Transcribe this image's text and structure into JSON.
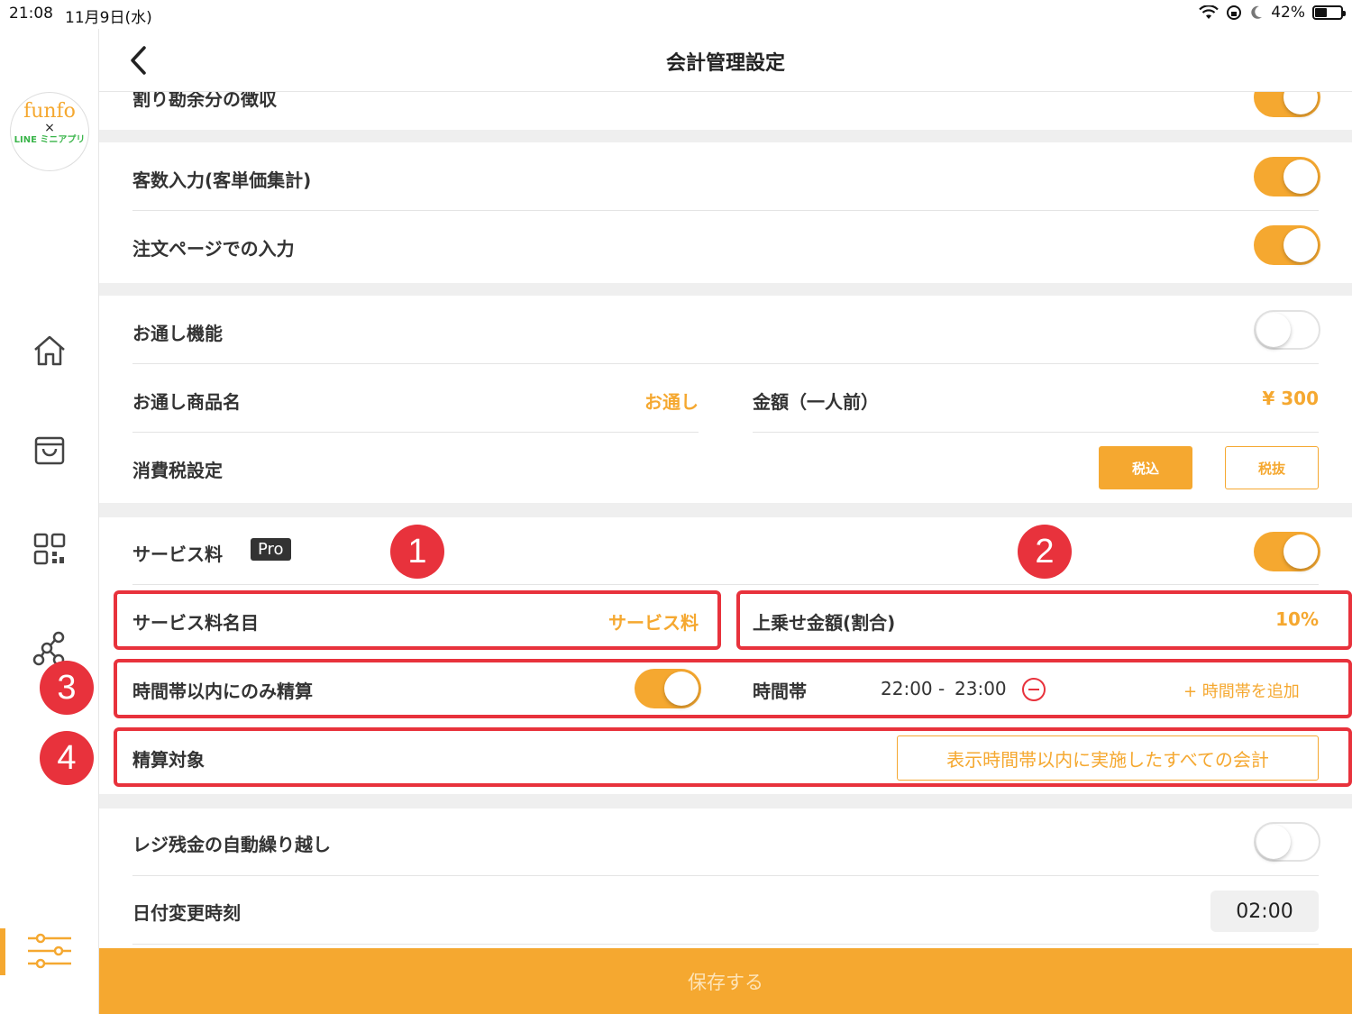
{
  "status": {
    "time": "21:08",
    "date": "11月9日(水)",
    "battery": "42%",
    "battery_level": 0.42
  },
  "logo": {
    "line1": "funfo",
    "line2": "×",
    "line3": "LINE ミニアプリ"
  },
  "header": {
    "title": "会計管理設定"
  },
  "rows": {
    "partial_top": "割り勘余分の徴収",
    "guest_count": "客数入力(客単価集計)",
    "order_page_input": "注文ページでの入力",
    "otoshi_feature": "お通し機能",
    "otoshi_name_label": "お通し商品名",
    "otoshi_name_value": "お通し",
    "amount_label": "金額（一人前）",
    "amount_value": "¥ 300",
    "tax_label": "消費税設定",
    "tax_included": "税込",
    "tax_excluded": "税抜",
    "service_fee": "サービス料",
    "pro_badge": "Pro",
    "service_name_label": "サービス料名目",
    "service_name_value": "サービス料",
    "surcharge_label": "上乗せ金額(割合)",
    "surcharge_value": "10%",
    "time_only_label": "時間帯以内にのみ精算",
    "time_slot_label": "時間帯",
    "time_start": "22:00 -",
    "time_end": "23:00",
    "add_time_slot": "+ 時間帯を追加",
    "settle_target_label": "精算対象",
    "settle_target_value": "表示時間帯以内に実施したすべての会計",
    "register_carryover": "レジ残金の自動繰り越し",
    "date_change_label": "日付変更時刻",
    "date_change_value": "02:00"
  },
  "toggles": {
    "partial_top": true,
    "guest_count": true,
    "order_page_input": true,
    "otoshi_feature": false,
    "service_fee": true,
    "time_only": true,
    "register_carryover": false
  },
  "annotations": [
    "1",
    "2",
    "3",
    "4"
  ],
  "save_button": "保存する",
  "colors": {
    "accent": "#f5a830",
    "annotation": "#e8323c"
  }
}
